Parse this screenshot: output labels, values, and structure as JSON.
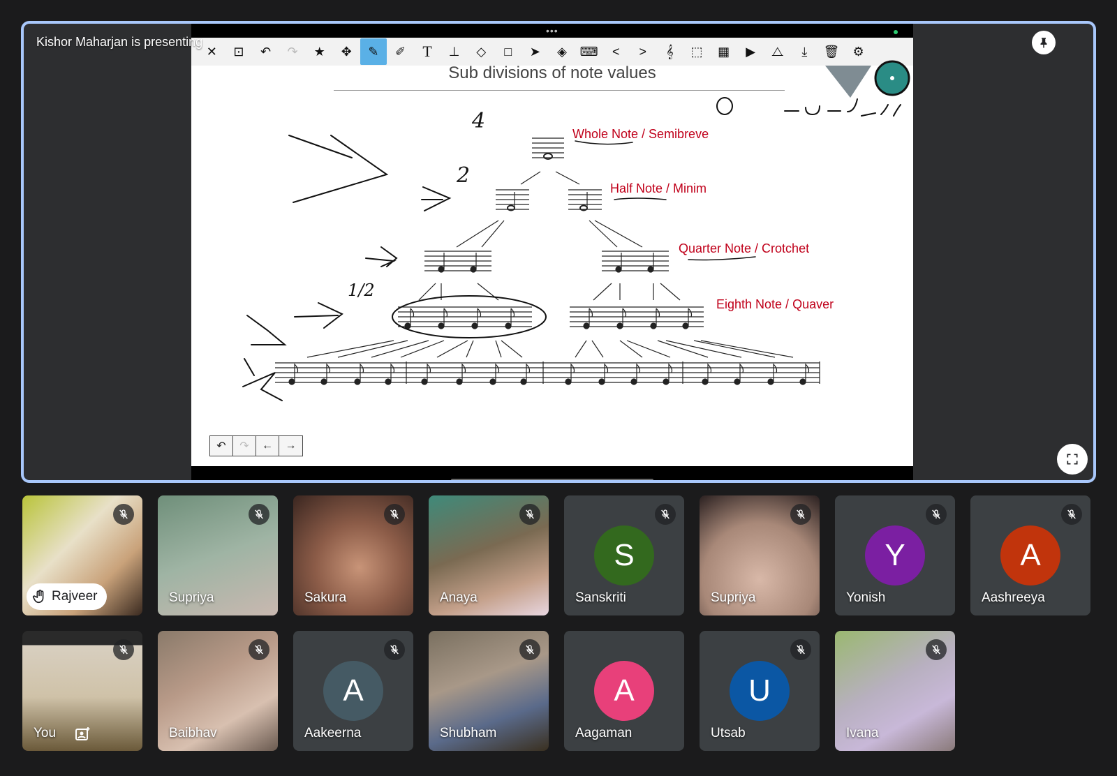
{
  "presentation": {
    "presenter_label": "Kishor Maharjan is presenting",
    "slide_title": "Sub divisions of note values",
    "note_labels": {
      "whole": "Whole Note / Semibreve",
      "half": "Half Note / Minim",
      "quarter": "Quarter Note / Crotchet",
      "eighth": "Eighth Note / Quaver"
    },
    "handwriting": {
      "four": "4",
      "two": "2",
      "half": "1/2"
    }
  },
  "participants_row1": [
    {
      "name": "Rajveer",
      "type": "video",
      "hand_raised": true
    },
    {
      "name": "Supriya",
      "type": "video"
    },
    {
      "name": "Sakura",
      "type": "video"
    },
    {
      "name": "Anaya",
      "type": "video"
    },
    {
      "name": "Sanskriti",
      "type": "avatar",
      "initial": "S",
      "color": "#33691e"
    },
    {
      "name": "Supriya",
      "type": "video"
    },
    {
      "name": "Yonish",
      "type": "avatar",
      "initial": "Y",
      "color": "#7b1fa2"
    },
    {
      "name": "Aashreeya",
      "type": "avatar",
      "initial": "A",
      "color": "#c1340c"
    }
  ],
  "participants_row2": [
    {
      "name": "You",
      "type": "video"
    },
    {
      "name": "Baibhav",
      "type": "video"
    },
    {
      "name": "Aakeerna",
      "type": "avatar",
      "initial": "A",
      "color": "#455a64"
    },
    {
      "name": "Shubham",
      "type": "video"
    },
    {
      "name": "Aagaman",
      "type": "avatar",
      "initial": "A",
      "color": "#e8407a"
    },
    {
      "name": "Utsab",
      "type": "avatar",
      "initial": "U",
      "color": "#0b57a4"
    },
    {
      "name": "Ivana",
      "type": "video"
    }
  ]
}
